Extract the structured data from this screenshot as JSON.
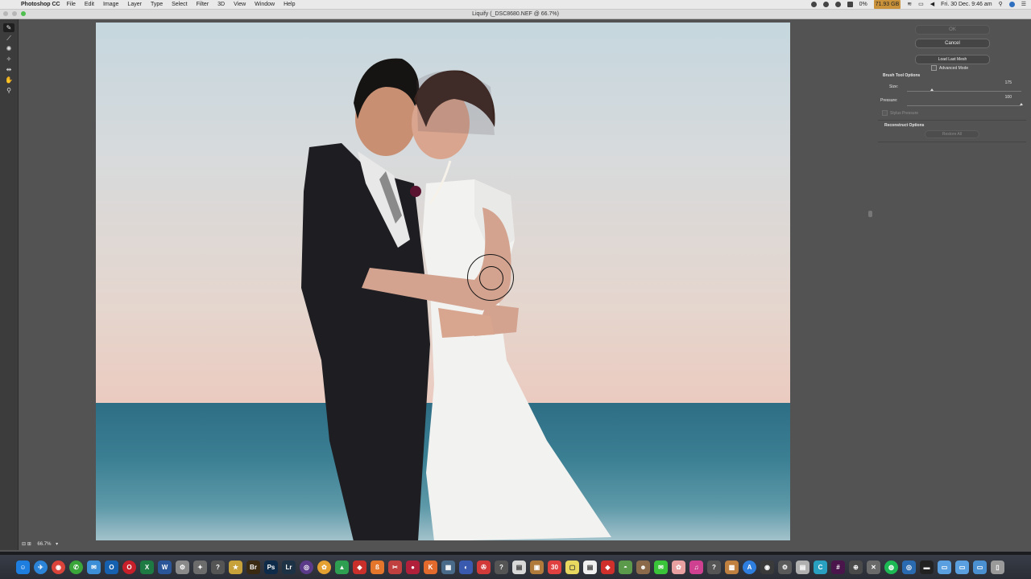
{
  "menubar": {
    "app_name": "Photoshop CC",
    "menus": [
      "File",
      "Edit",
      "Image",
      "Layer",
      "Type",
      "Select",
      "Filter",
      "3D",
      "View",
      "Window",
      "Help"
    ],
    "status_percent": "0%",
    "disk_free": "71.93 GB",
    "datetime": "Fri. 30 Dec.  9:46 am"
  },
  "window": {
    "title": "Liquify (_DSC8680.NEF @ 66.7%)"
  },
  "toolbar": {
    "tools": [
      {
        "name": "forward-warp-tool",
        "glyph": "✎",
        "active": true
      },
      {
        "name": "reconstruct-tool",
        "glyph": "⟋",
        "active": false
      },
      {
        "name": "twirl-tool",
        "glyph": "✺",
        "active": false
      },
      {
        "name": "pucker-tool",
        "glyph": "✧",
        "active": false
      },
      {
        "name": "push-left-tool",
        "glyph": "⇹",
        "active": false
      },
      {
        "name": "hand-tool",
        "glyph": "✋",
        "active": false
      },
      {
        "name": "zoom-tool",
        "glyph": "⚲",
        "active": false
      }
    ]
  },
  "panel": {
    "ok_label": "OK",
    "cancel_label": "Cancel",
    "load_last_mesh_label": "Load Last Mesh",
    "advanced_mode_label": "Advanced Mode",
    "brush_tool_options_title": "Brush Tool Options",
    "size_label": "Size:",
    "size_value": "175",
    "size_fraction": 0.22,
    "pressure_label": "Pressure:",
    "pressure_value": "100",
    "pressure_fraction": 1.0,
    "stylus_pressure_label": "Stylus Pressure",
    "reconstruct_options_title": "Reconstruct Options",
    "restore_all_label": "Restore All"
  },
  "statusbar": {
    "zoom": "66.7%"
  },
  "dock": {
    "apps": [
      {
        "name": "finder",
        "glyph": "☺",
        "color": "#1d7ee0"
      },
      {
        "name": "safari",
        "glyph": "✈",
        "color": "#2b84d8"
      },
      {
        "name": "chrome",
        "glyph": "◉",
        "color": "#d9433a"
      },
      {
        "name": "facetime",
        "glyph": "✆",
        "color": "#3aa63a"
      },
      {
        "name": "mail",
        "glyph": "✉",
        "color": "#3c8fd6"
      },
      {
        "name": "outlook",
        "glyph": "O",
        "color": "#1660b0"
      },
      {
        "name": "opera",
        "glyph": "O",
        "color": "#c8202a"
      },
      {
        "name": "excel",
        "glyph": "X",
        "color": "#1d7a42"
      },
      {
        "name": "word",
        "glyph": "W",
        "color": "#2a5699"
      },
      {
        "name": "settings",
        "glyph": "⚙",
        "color": "#8a8a8a"
      },
      {
        "name": "launchpad",
        "glyph": "✦",
        "color": "#6c6c6c"
      },
      {
        "name": "help",
        "glyph": "?",
        "color": "#555"
      },
      {
        "name": "app-yellow",
        "glyph": "★",
        "color": "#c7a23a"
      },
      {
        "name": "bridge",
        "glyph": "Br",
        "color": "#3a2b12"
      },
      {
        "name": "photoshop",
        "glyph": "Ps",
        "color": "#0e2c4a"
      },
      {
        "name": "lightroom",
        "glyph": "Lr",
        "color": "#1e3246"
      },
      {
        "name": "app-circle",
        "glyph": "◎",
        "color": "#5b3a8a"
      },
      {
        "name": "photos",
        "glyph": "✿",
        "color": "#e4a030"
      },
      {
        "name": "drive",
        "glyph": "▲",
        "color": "#2e9e50"
      },
      {
        "name": "app-red",
        "glyph": "◆",
        "color": "#c9302c"
      },
      {
        "name": "app-orange",
        "glyph": "ß",
        "color": "#e3762a"
      },
      {
        "name": "app-tool",
        "glyph": "✂",
        "color": "#c04040"
      },
      {
        "name": "app-pink",
        "glyph": "●",
        "color": "#b0203a"
      },
      {
        "name": "app-k",
        "glyph": "K",
        "color": "#e26a2c"
      },
      {
        "name": "app-grid",
        "glyph": "▦",
        "color": "#4a6a8a"
      },
      {
        "name": "app-blue",
        "glyph": "◐",
        "color": "#3a5ab0"
      },
      {
        "name": "app-compass",
        "glyph": "✇",
        "color": "#d23a3a"
      },
      {
        "name": "help-2",
        "glyph": "?",
        "color": "#555"
      },
      {
        "name": "notes",
        "glyph": "▤",
        "color": "#d8d8d8"
      },
      {
        "name": "app-brown",
        "glyph": "▣",
        "color": "#b07a3a"
      },
      {
        "name": "calendar",
        "glyph": "30",
        "color": "#e04040"
      },
      {
        "name": "stickies",
        "glyph": "▢",
        "color": "#e8d860"
      },
      {
        "name": "textedit",
        "glyph": "▤",
        "color": "#f0f0f0"
      },
      {
        "name": "app-red-2",
        "glyph": "◆",
        "color": "#d0302c"
      },
      {
        "name": "app-maps",
        "glyph": "◓",
        "color": "#5a9a4a"
      },
      {
        "name": "contacts",
        "glyph": "☻",
        "color": "#8a6a4a"
      },
      {
        "name": "messages",
        "glyph": "✉",
        "color": "#3ac43a"
      },
      {
        "name": "app-photo",
        "glyph": "✿",
        "color": "#e8a0a0"
      },
      {
        "name": "itunes",
        "glyph": "♫",
        "color": "#d04090"
      },
      {
        "name": "help-3",
        "glyph": "?",
        "color": "#555"
      },
      {
        "name": "app-box",
        "glyph": "▩",
        "color": "#c08040"
      },
      {
        "name": "app-store",
        "glyph": "A",
        "color": "#2e7ee0"
      },
      {
        "name": "app-lens",
        "glyph": "◉",
        "color": "#3a3a3a"
      },
      {
        "name": "app-gear",
        "glyph": "⚙",
        "color": "#5a5a5a"
      },
      {
        "name": "app-doc",
        "glyph": "▤",
        "color": "#b0b0b0"
      },
      {
        "name": "app-c",
        "glyph": "C",
        "color": "#2aa0c0"
      },
      {
        "name": "app-slack",
        "glyph": "#",
        "color": "#4a154b"
      },
      {
        "name": "app-globe",
        "glyph": "⊕",
        "color": "#4a4a4a"
      },
      {
        "name": "app-x",
        "glyph": "✕",
        "color": "#6a6a6a"
      },
      {
        "name": "spotify",
        "glyph": "◍",
        "color": "#1db954"
      },
      {
        "name": "app-blue-2",
        "glyph": "◎",
        "color": "#2a6ab0"
      },
      {
        "name": "terminal",
        "glyph": "▬",
        "color": "#222"
      },
      {
        "name": "folder-documents",
        "glyph": "▭",
        "color": "#5aa0e0"
      },
      {
        "name": "folder-downloads",
        "glyph": "▭",
        "color": "#5aa0e0"
      },
      {
        "name": "folder-apps",
        "glyph": "▭",
        "color": "#4a90d0"
      },
      {
        "name": "trash",
        "glyph": "▯",
        "color": "#9a9a9a"
      }
    ]
  }
}
